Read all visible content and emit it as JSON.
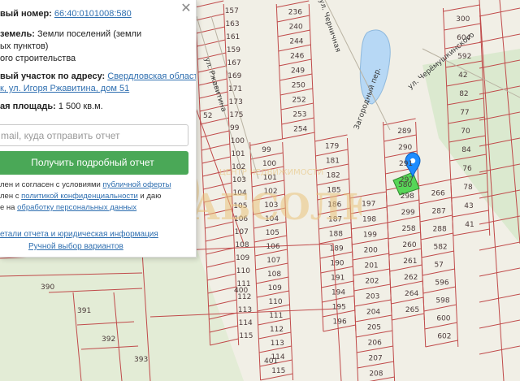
{
  "panel": {
    "cadastral_label": "вый номер:",
    "cadastral_number": "66:40:0101008:580",
    "land_category_label": "земель:",
    "land_category_value_1": "Земли поселений (земли",
    "land_category_value_2": "ых пунктов)",
    "land_use_value": "ого строительства",
    "address_label": "вый участок по адресу:",
    "address_link_1": "Свердловская область,",
    "address_link_2": "к, ул. Игоря Ржавитина, дом 51",
    "area_label": "ая площадь:",
    "area_value": "1 500 кв.м.",
    "email_placeholder": "mail, куда отправить отчет",
    "order_button": "Получить подробный отчет",
    "consent_1_pre": "лен и согласен с условиями ",
    "consent_1_link": "публичной оферты",
    "consent_2_pre": "лен с ",
    "consent_2_link": "политикой конфиденциальности",
    "consent_2_post": " и даю",
    "consent_3_pre": "е на ",
    "consent_3_link": "обработку персональных данных",
    "details_link": "етали отчета и юридическая информация",
    "manual_link": "Ручной выбор вариантов",
    "close_glyph": "✕"
  },
  "map": {
    "streets": [
      "ул. Ржавитина",
      "ул. Черничная",
      "ул. Черёмушкинского",
      "Загородный пер."
    ],
    "plots_left": [
      "157",
      "163",
      "161",
      "159",
      "167",
      "169",
      "171",
      "173",
      "175",
      "99",
      "100",
      "101",
      "102",
      "103",
      "104",
      "105",
      "106",
      "107",
      "108",
      "109",
      "110",
      "111",
      "112",
      "113",
      "114",
      "115"
    ],
    "plots_mid": [
      "236",
      "240",
      "244",
      "246",
      "249",
      "250",
      "252",
      "253",
      "254",
      "179",
      "181",
      "182",
      "185",
      "186",
      "187",
      "188",
      "189",
      "190",
      "191",
      "194",
      "195",
      "196",
      "197",
      "198",
      "199",
      "200",
      "201",
      "202",
      "203",
      "204",
      "205",
      "206",
      "207",
      "208"
    ],
    "plots_right": [
      "289",
      "290",
      "291",
      "297",
      "298",
      "299",
      "258",
      "260",
      "261",
      "262",
      "264",
      "265",
      "266",
      "287",
      "288",
      "582",
      "57",
      "596",
      "598",
      "600",
      "602"
    ],
    "plots_far": [
      "300",
      "604",
      "592",
      "42",
      "82",
      "77",
      "70",
      "84",
      "76",
      "78",
      "43",
      "41"
    ],
    "plots_bottom": [
      "390",
      "391",
      "392",
      "393",
      "400",
      "401",
      "52"
    ],
    "selected_plot": "580",
    "marker_icon": "map-pin-icon",
    "watermark_text": "АБСОЛЮТ",
    "watermark_subtitle": "ЦЕНТР НЕДВИЖИМОСТИ",
    "colors": {
      "parcel_line": "#c04a4a",
      "selected_fill": "#57d657",
      "marker": "#1f8cff",
      "water": "#b7d8f5",
      "forest": "#cfe3c2"
    }
  }
}
